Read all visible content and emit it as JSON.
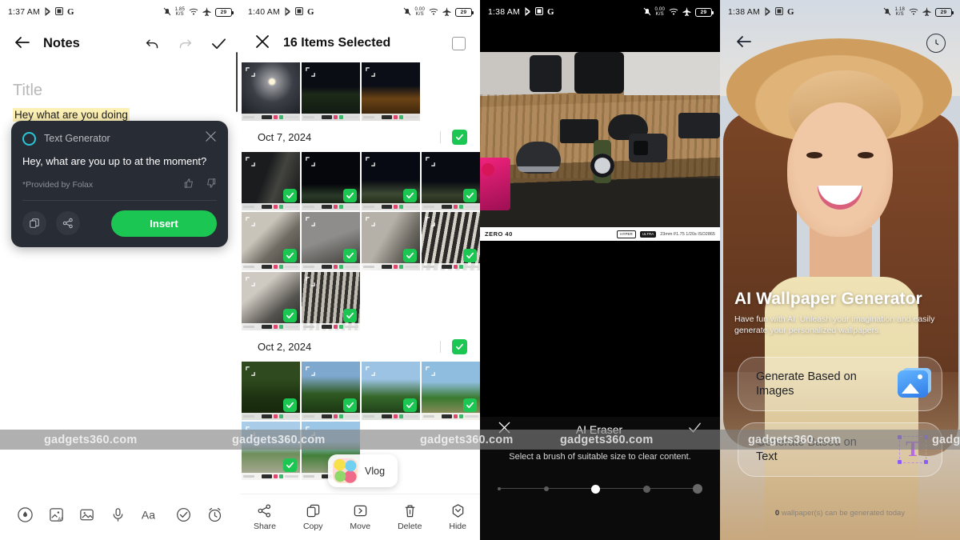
{
  "watermark": {
    "text": "gadgets360.com",
    "positions": [
      55,
      290,
      525,
      700,
      935,
      1165
    ]
  },
  "panel1": {
    "statusbar": {
      "time": "1:37 AM",
      "net_rate": "1.85",
      "net_unit": "K/S",
      "battery": "29",
      "icons": [
        "bluetooth-icon",
        "cast-icon",
        "google-icon",
        "notification-off-icon",
        "wifi-icon",
        "airplane-mode-icon",
        "battery-icon"
      ]
    },
    "appbar": {
      "back": "back-arrow-icon",
      "title": "Notes",
      "undo": "undo-icon",
      "redo": "redo-icon",
      "done": "checkmark-icon"
    },
    "note": {
      "title_placeholder": "Title",
      "body": "Hey what are you doing"
    },
    "text_generator": {
      "name": "Text Generator",
      "result": "Hey, what are you up to at the moment?",
      "provider": "*Provided by Folax",
      "insert_label": "Insert",
      "accent": "#29c6d8",
      "insert_color": "#1bc653"
    },
    "toolbar": [
      {
        "name": "draw-icon",
        "label": "Draw"
      },
      {
        "name": "ai-image-icon",
        "label": "AI Image"
      },
      {
        "name": "image-icon",
        "label": "Image"
      },
      {
        "name": "microphone-icon",
        "label": "Voice"
      },
      {
        "name": "text-format-icon",
        "label": "Aa"
      },
      {
        "name": "checklist-icon",
        "label": "Checklist"
      },
      {
        "name": "reminder-icon",
        "label": "Reminder"
      }
    ]
  },
  "panel2": {
    "statusbar": {
      "time": "1:40 AM",
      "net_rate": "0.00",
      "net_unit": "K/S",
      "battery": "29"
    },
    "appbar": {
      "close": "close-icon",
      "title": "16 Items Selected",
      "select_all": "select-all-checkbox"
    },
    "sections": [
      {
        "date": null,
        "selected_all": false,
        "thumbs": [
          {
            "selected": false,
            "kind": "moon-clouds"
          },
          {
            "selected": false,
            "kind": "night-street"
          },
          {
            "selected": false,
            "kind": "night-street-orange"
          }
        ]
      },
      {
        "date": "Oct 7, 2024",
        "selected_all": true,
        "thumbs": [
          {
            "selected": true,
            "kind": "night-building"
          },
          {
            "selected": true,
            "kind": "night-tower"
          },
          {
            "selected": true,
            "kind": "night-tower-lit"
          },
          {
            "selected": true,
            "kind": "night-tower-wide"
          },
          {
            "selected": true,
            "kind": "interior-stairs"
          },
          {
            "selected": true,
            "kind": "interior-grey"
          },
          {
            "selected": true,
            "kind": "interior-steps"
          },
          {
            "selected": true,
            "kind": "interior-blinds"
          },
          {
            "selected": true,
            "kind": "interior-rail"
          },
          {
            "selected": true,
            "kind": "interior-vent"
          }
        ]
      },
      {
        "date": "Oct 2, 2024",
        "selected_all": true,
        "thumbs": [
          {
            "selected": true,
            "kind": "forest-trunks"
          },
          {
            "selected": true,
            "kind": "forest-canopy"
          },
          {
            "selected": true,
            "kind": "forest-sky"
          },
          {
            "selected": true,
            "kind": "roadside-trees"
          },
          {
            "selected": true,
            "kind": "open-road"
          },
          {
            "selected": true,
            "kind": "road-trees"
          }
        ]
      }
    ],
    "vlog_chip": {
      "label": "Vlog",
      "icon": "vlog-app-icon"
    },
    "bottom_actions": [
      {
        "name": "share-action",
        "label": "Share",
        "icon": "share-icon"
      },
      {
        "name": "copy-action",
        "label": "Copy",
        "icon": "copy-icon"
      },
      {
        "name": "move-action",
        "label": "Move",
        "icon": "move-icon"
      },
      {
        "name": "delete-action",
        "label": "Delete",
        "icon": "trash-icon"
      },
      {
        "name": "hide-action",
        "label": "Hide",
        "icon": "hide-icon"
      }
    ]
  },
  "panel3": {
    "statusbar": {
      "time": "1:38 AM",
      "net_rate": "0.00",
      "net_unit": "K/S",
      "battery": "29"
    },
    "photo_exif": {
      "brand": "ZERO 40",
      "badge1": "HYPER\\nOCTA",
      "badge2": "ULTRA",
      "data": "23mm f/1.75 1/20s ISO2865"
    },
    "eraser": {
      "close": "close-icon",
      "title": "AI Eraser",
      "confirm": "checkmark-icon",
      "hint": "Select a brush of suitable size to clear content.",
      "brush_sizes": [
        1,
        2,
        3,
        4,
        5
      ],
      "brush_selected": 3
    }
  },
  "panel4": {
    "statusbar": {
      "time": "1:38 AM",
      "net_rate": "1.18",
      "net_unit": "K/S",
      "battery": "29"
    },
    "appbar": {
      "back": "back-arrow-icon",
      "history": "history-clock-icon"
    },
    "hero": {
      "title": "AI Wallpaper Generator",
      "subtitle": "Have fun with AI. Unleash your imagination and easily generate your personalized wallpapers."
    },
    "options": [
      {
        "label": "Generate Based on Images",
        "icon": "image-stack-icon"
      },
      {
        "label": "Generate Based on Text",
        "icon": "text-tool-icon"
      }
    ],
    "footer": {
      "count": "0",
      "text": " wallpaper(s) can be generated today"
    }
  }
}
